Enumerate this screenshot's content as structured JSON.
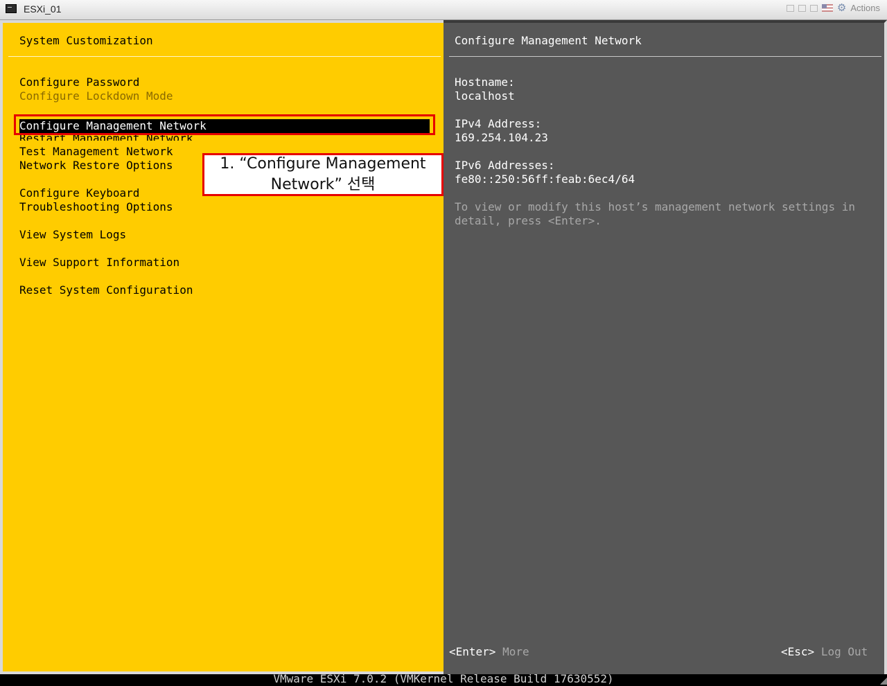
{
  "window": {
    "title": "ESXi_01",
    "actions_label": "Actions"
  },
  "left": {
    "header": "System Customization",
    "items": [
      {
        "label": "Configure Password"
      },
      {
        "label": "Configure Lockdown Mode"
      },
      {
        "label": "Configure Management Network"
      },
      {
        "label": "Restart Management Network"
      },
      {
        "label": "Test Management Network"
      },
      {
        "label": "Network Restore Options"
      },
      {
        "label": "Configure Keyboard"
      },
      {
        "label": "Troubleshooting Options"
      },
      {
        "label": "View System Logs"
      },
      {
        "label": "View Support Information"
      },
      {
        "label": "Reset System Configuration"
      }
    ],
    "callout": "1. “Configure Management Network” 선택"
  },
  "right": {
    "header": "Configure Management Network",
    "hostname_label": "Hostname:",
    "hostname_value": "localhost",
    "ipv4_label": "IPv4 Address:",
    "ipv4_value": "169.254.104.23",
    "ipv6_label": "IPv6 Addresses:",
    "ipv6_value": "fe80::250:56ff:feab:6ec4/64",
    "help_line1": "To view or modify this host’s management network settings in",
    "help_line2": "detail, press <Enter>.",
    "enter_key": "<Enter>",
    "enter_action": "More",
    "esc_key": "<Esc>",
    "esc_action": "Log Out"
  },
  "status": "VMware ESXi 7.0.2 (VMKernel Release Build 17630552)",
  "colors": {
    "left_bg": "#ffcc00",
    "right_bg": "#575757",
    "highlight": "#e60000"
  }
}
